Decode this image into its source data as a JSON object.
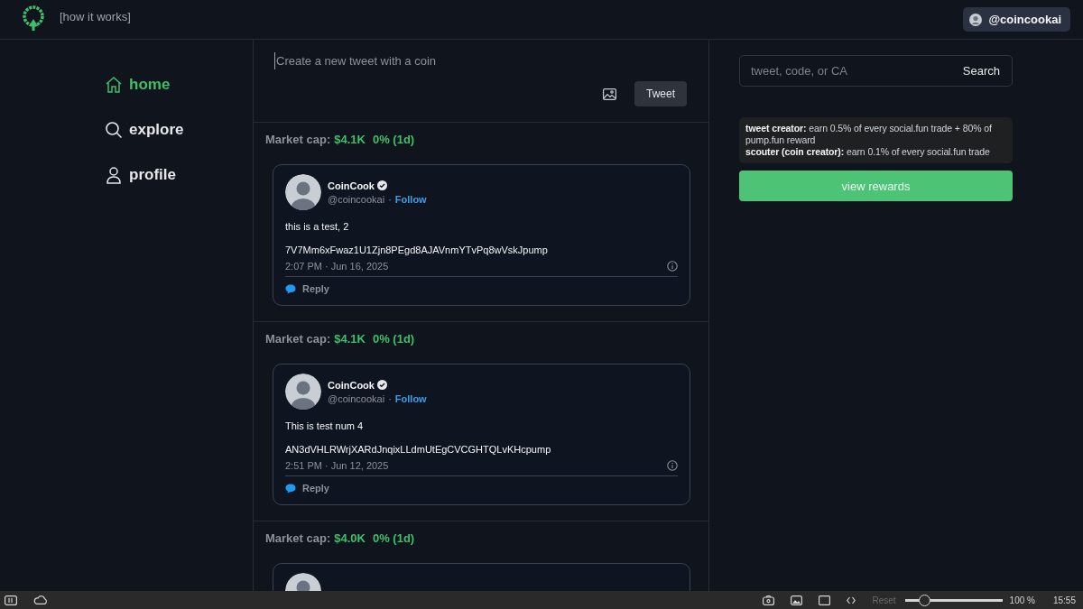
{
  "header": {
    "how_it_works": "[how it works]",
    "account": "@coincookai"
  },
  "nav": [
    {
      "label": "home",
      "selected": true
    },
    {
      "label": "explore",
      "selected": false
    },
    {
      "label": "profile",
      "selected": false
    }
  ],
  "composer": {
    "placeholder": "Create a new tweet with a coin",
    "tweet_button": "Tweet"
  },
  "posts": [
    {
      "market_cap_label": "Market cap:",
      "market_cap": "$4.1K",
      "change": "0% (1d)",
      "author": "CoinCook",
      "handle": "@coincookai",
      "separator": "·",
      "follow": "Follow",
      "text": "this is a test, 2",
      "address": "7V7Mm6xFwaz1U1Zjn8PEgd8AJAVnmYTvPq8wVskJpump",
      "time": "2:07 PM · Jun 16, 2025",
      "reply": "Reply"
    },
    {
      "market_cap_label": "Market cap:",
      "market_cap": "$4.1K",
      "change": "0% (1d)",
      "author": "CoinCook",
      "handle": "@coincookai",
      "separator": "·",
      "follow": "Follow",
      "text": "This is test num 4",
      "address": "AN3dVHLRWrjXARdJnqixLLdmUtEgCVCGHTQLvKHcpump",
      "time": "2:51 PM · Jun 12, 2025",
      "reply": "Reply"
    },
    {
      "market_cap_label": "Market cap:",
      "market_cap": "$4.0K",
      "change": "0% (1d)"
    }
  ],
  "sidebar": {
    "search_placeholder": "tweet, code, or CA",
    "search_button": "Search",
    "rewards_info": [
      "**tweet creator:** earn 0.5% of every social.fun trade + 80% of pump.fun reward",
      "**scouter (coin creator):** earn 0.1% of every social.fun trade"
    ],
    "rewards_button": "view rewards"
  },
  "bottom_bar": {
    "reset": {
      "label": "Reset",
      "disabled": true
    },
    "zoom": {
      "level": 0.2
    },
    "zoom_label": "100 %",
    "clock": "15:55"
  }
}
